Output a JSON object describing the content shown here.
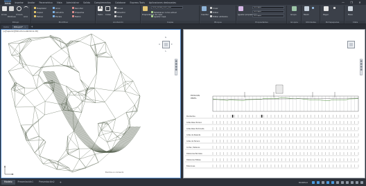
{
  "menu_tabs": [
    "Inicio",
    "Insertar",
    "Anotar",
    "Parametrico",
    "Vista",
    "Administrar",
    "Salida",
    "Complementos",
    "Colaborar",
    "Express Tools",
    "Aplicaciones destacadas"
  ],
  "window_controls": [
    "—",
    "❐",
    "✕"
  ],
  "ribbon": {
    "groups": [
      "Dibujo",
      "Modificar",
      "Anotación",
      "Capas",
      "Bloque",
      "Propiedades",
      "Grupos",
      "Utilidades",
      "Portapapeles",
      "Vista"
    ],
    "draw_labels": [
      "Línea",
      "Polilínea",
      "Círculo",
      "Arco"
    ],
    "modify_labels": [
      "Desplazar",
      "Girar",
      "Recortar",
      "Copiar",
      "Simetría",
      "Empalme",
      "Estirar",
      "Escala",
      "Matriz"
    ],
    "annotation_labels": [
      "Texto",
      "Cotas",
      "Lineal",
      "Directriz",
      "Tabla"
    ],
    "layers_labels": [
      "Propiedades de capa",
      "Establecer como actual",
      "Igualar capa"
    ],
    "layer_current": "DES_LONG_EDIF_LIN",
    "block_labels": [
      "Insertar",
      "Crear",
      "Editar",
      "Editar atributos"
    ],
    "properties_labels": [
      "Igualar propiedades"
    ],
    "prop_color": "PorCapa",
    "prop_linetype": "PorCapa",
    "prop_lineweight": "PorCapa",
    "groups_labels": [
      "Grupo"
    ],
    "utilities_labels": [
      "Medir"
    ],
    "clipboard_labels": [
      "Pegar"
    ],
    "view_labels": [
      "Base"
    ]
  },
  "file_tabs": [
    {
      "label": "Inicio",
      "active": false
    },
    {
      "label": "Dibujo1*",
      "active": true
    }
  ],
  "viewport_left": {
    "label": "[+][Superior][Estructura alámbrica 2D]",
    "compass": [
      "N",
      "S",
      "E",
      "O"
    ],
    "cmd_prompt": "Escriba un comando"
  },
  "viewport_right": {
    "profile_title_lines": [
      "ESTACION",
      "PERFIL"
    ],
    "rows": [
      "Pendientes",
      "Cotas Rasa Terreno",
      "Cotas Rasa Terminada",
      "Cotas de Rasante",
      "Cotas de Terreno",
      "Cortes / Rellenos",
      "Distancias Parciales",
      "Distancias Totales",
      "Estaciones"
    ]
  },
  "layout_tabs": [
    {
      "label": "Modelo",
      "active": true
    },
    {
      "label": "Presentación1",
      "active": false
    },
    {
      "label": "Presentación2",
      "active": false
    }
  ],
  "status_text": "MODELO",
  "colors": {
    "accent": "#4c9be0",
    "mesh": "#5e6a57",
    "mesh_dark": "#3d4a36",
    "ribbon_bg": "#3b4049",
    "profile_grid": "#8a8f96"
  }
}
